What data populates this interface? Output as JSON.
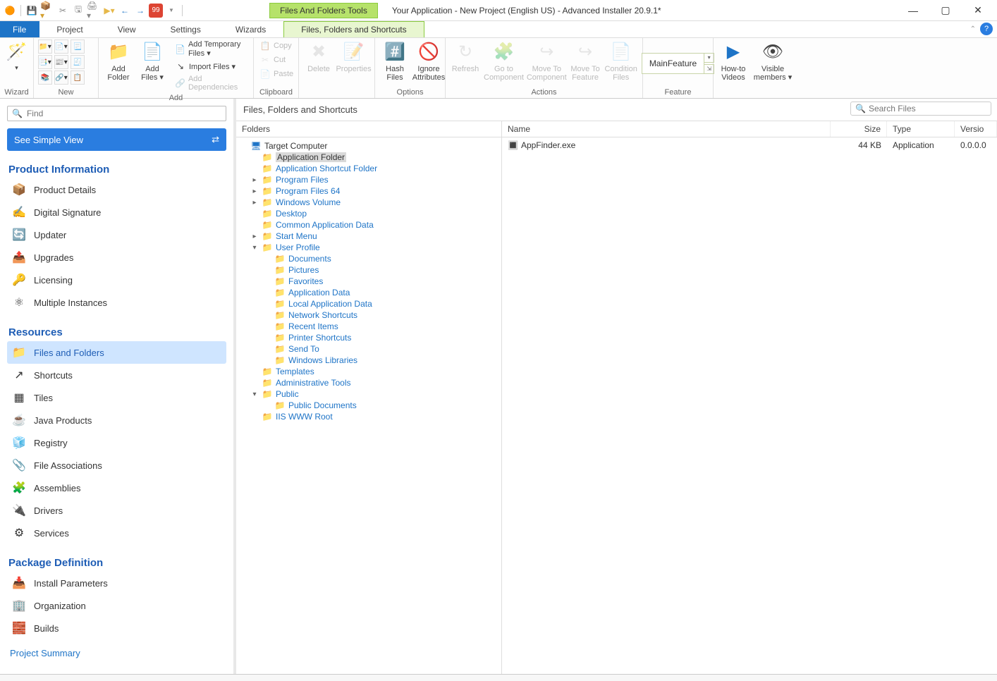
{
  "titlebar": {
    "context_tools": "Files And Folders Tools",
    "title": "Your Application - New Project (English US) - Advanced Installer 20.9.1*"
  },
  "menubar": {
    "file": "File",
    "project": "Project",
    "view": "View",
    "settings": "Settings",
    "wizards": "Wizards",
    "files_tab": "Files, Folders and Shortcuts"
  },
  "ribbon": {
    "wizard": "Wizard",
    "new_group": "New",
    "add_folder": "Add\nFolder",
    "add_files": "Add\nFiles ▾",
    "add_temp": "Add Temporary Files ▾",
    "import_files": "Import Files ▾",
    "add_deps": "Add Dependencies",
    "add_group": "Add",
    "copy": "Copy",
    "cut": "Cut",
    "paste": "Paste",
    "clipboard": "Clipboard",
    "delete": "Delete",
    "properties": "Properties",
    "hash": "Hash\nFiles",
    "ignore": "Ignore\nAttributes",
    "options": "Options",
    "refresh": "Refresh",
    "goto": "Go to\nComponent",
    "move_comp": "Move To\nComponent",
    "move_feat": "Move To\nFeature",
    "condition": "Condition\nFiles",
    "actions": "Actions",
    "main_feature": "MainFeature",
    "feature": "Feature",
    "howto": "How-to\nVideos",
    "visible": "Visible\nmembers ▾"
  },
  "left": {
    "find_placeholder": "Find",
    "simple_view": "See Simple View",
    "product_info": "Product Information",
    "product_details": "Product Details",
    "digital_sig": "Digital Signature",
    "updater": "Updater",
    "upgrades": "Upgrades",
    "licensing": "Licensing",
    "multi_inst": "Multiple Instances",
    "resources": "Resources",
    "files_folders": "Files and Folders",
    "shortcuts": "Shortcuts",
    "tiles": "Tiles",
    "java": "Java Products",
    "registry": "Registry",
    "file_assoc": "File Associations",
    "assemblies": "Assemblies",
    "drivers": "Drivers",
    "services": "Services",
    "pkg_def": "Package Definition",
    "install_params": "Install Parameters",
    "organization": "Organization",
    "builds": "Builds",
    "project_summary": "Project Summary"
  },
  "content": {
    "title": "Files, Folders and Shortcuts",
    "folders_header": "Folders",
    "search_placeholder": "Search Files",
    "cols": {
      "name": "Name",
      "size": "Size",
      "type": "Type",
      "version": "Versio"
    },
    "file": {
      "name": "AppFinder.exe",
      "size": "44 KB",
      "type": "Application",
      "version": "0.0.0.0"
    }
  },
  "tree": {
    "target": "Target Computer",
    "app_folder": "Application Folder",
    "app_shortcut": "Application Shortcut Folder",
    "program_files": "Program Files",
    "program_files64": "Program Files 64",
    "win_volume": "Windows Volume",
    "desktop": "Desktop",
    "common_appdata": "Common Application Data",
    "start_menu": "Start Menu",
    "user_profile": "User Profile",
    "documents": "Documents",
    "pictures": "Pictures",
    "favorites": "Favorites",
    "appdata": "Application Data",
    "local_appdata": "Local Application Data",
    "network": "Network Shortcuts",
    "recent": "Recent Items",
    "printer": "Printer Shortcuts",
    "sendto": "Send To",
    "winlib": "Windows Libraries",
    "templates": "Templates",
    "admin_tools": "Administrative Tools",
    "public": "Public",
    "public_docs": "Public Documents",
    "iis": "IIS WWW Root"
  }
}
